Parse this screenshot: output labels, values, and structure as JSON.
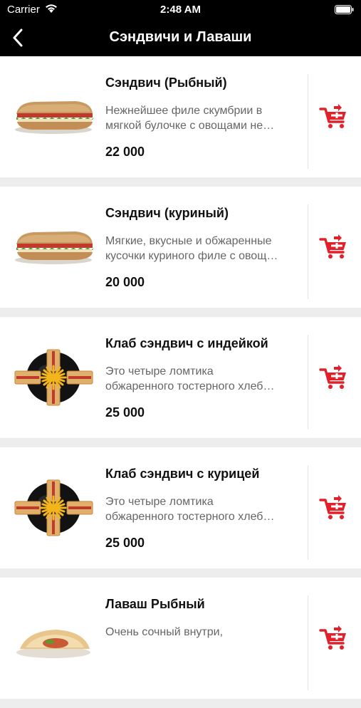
{
  "status_bar": {
    "carrier": "Carrier",
    "time": "2:48 AM"
  },
  "nav": {
    "title": "Сэндвичи и Лаваши",
    "back_icon": "chevron-left-icon"
  },
  "colors": {
    "accent": "#e3202a",
    "bar": "#000000",
    "background": "#ededed"
  },
  "products": [
    {
      "name": "Сэндвич (Рыбный)",
      "desc_line1": "Нежнейшее филе скумбрии в",
      "desc_line2": "мягкой булочке с овощами не…",
      "price": "22 000",
      "image": "long-sandwich"
    },
    {
      "name": "Сэндвич (куриный)",
      "desc_line1": "Мягкие, вкусные и обжаренные",
      "desc_line2": "кусочки куриного филе с овощ…",
      "price": "20 000",
      "image": "long-sandwich"
    },
    {
      "name": "Клаб сэндвич с индейкой",
      "desc_line1": "Это четыре ломтика",
      "desc_line2": "обжаренного тостерного хлеб…",
      "price": "25 000",
      "image": "club-sandwich"
    },
    {
      "name": "Клаб сэндвич с курицей",
      "desc_line1": "Это четыре ломтика",
      "desc_line2": "обжаренного тостерного хлеб…",
      "price": "25 000",
      "image": "club-sandwich"
    },
    {
      "name": "Лаваш Рыбный",
      "desc_line1": "Очень сочный внутри,",
      "desc_line2": "",
      "price": "",
      "image": "lavash-roll"
    }
  ]
}
